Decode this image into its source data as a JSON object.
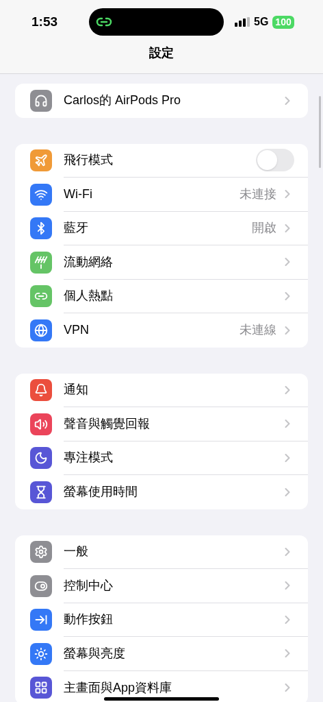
{
  "status_bar": {
    "time": "1:53",
    "network": "5G",
    "battery": "100"
  },
  "title": "設定",
  "groups": [
    {
      "rows": [
        {
          "label": "Carlos的 AirPods Pro",
          "kind": "link",
          "color": "#8e8e93"
        }
      ]
    },
    {
      "rows": [
        {
          "label": "飛行模式",
          "kind": "toggle",
          "on": false,
          "color": "#f09a37"
        },
        {
          "label": "Wi-Fi",
          "kind": "link",
          "value": "未連接",
          "color": "#3478f6"
        },
        {
          "label": "藍牙",
          "kind": "link",
          "value": "開啟",
          "color": "#3478f6"
        },
        {
          "label": "流動網絡",
          "kind": "link",
          "color": "#65c466"
        },
        {
          "label": "個人熱點",
          "kind": "link",
          "color": "#65c466"
        },
        {
          "label": "VPN",
          "kind": "link",
          "value": "未連線",
          "color": "#3478f6"
        }
      ]
    },
    {
      "rows": [
        {
          "label": "通知",
          "kind": "link",
          "color": "#eb4e3d"
        },
        {
          "label": "聲音與觸覺回報",
          "kind": "link",
          "color": "#eb445a"
        },
        {
          "label": "專注模式",
          "kind": "link",
          "color": "#5856d6"
        },
        {
          "label": "螢幕使用時間",
          "kind": "link",
          "color": "#5856d6"
        }
      ]
    },
    {
      "rows": [
        {
          "label": "一般",
          "kind": "link",
          "color": "#8e8e93"
        },
        {
          "label": "控制中心",
          "kind": "link",
          "color": "#8e8e93"
        },
        {
          "label": "動作按鈕",
          "kind": "link",
          "color": "#3478f6"
        },
        {
          "label": "螢幕與亮度",
          "kind": "link",
          "color": "#3478f6"
        },
        {
          "label": "主畫面與App資料庫",
          "kind": "link",
          "color": "#5856d6"
        }
      ]
    }
  ]
}
